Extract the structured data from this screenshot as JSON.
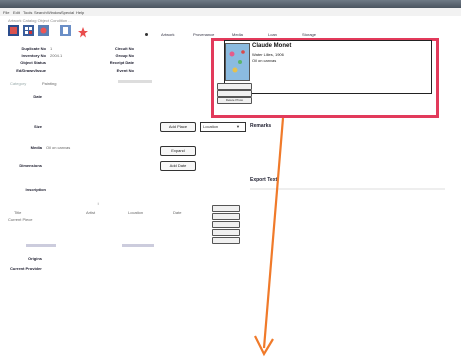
{
  "window": {
    "title": ""
  },
  "menu": {
    "items": [
      "File",
      "Edit",
      "Tools",
      "Search",
      "Window",
      "Special",
      "Help"
    ]
  },
  "breadcrumb": "Artwork  Catalog  Object  Condition  ...",
  "tabs": [
    "Artwork",
    "Provenance",
    "Media",
    "Loan",
    "Storage"
  ],
  "fields": {
    "duplicate_label": "Duplicate No",
    "duplicate_value": "1",
    "inventory_label": "Inventory No",
    "inventory_value": "2004.1",
    "object_status_label": "Object Status",
    "object_status_value": "",
    "ed_label": "Ed/Drawn/Issue",
    "ed_value": "",
    "category_label": "Category",
    "category_value": "Painting",
    "date_label": "Date",
    "date_value": "",
    "circuit_label": "Circuit No",
    "circuit_value": "",
    "group_label": "Group No",
    "group_value": "",
    "receipt_label": "Receipt Date",
    "receipt_value": "",
    "event_label": "Event No",
    "event_value": "",
    "size_label": "Size",
    "size_value": "",
    "media_label": "Media",
    "media_value": "Oil on canvas",
    "dimensions_label": "Dimensions",
    "dimensions_value": "",
    "inscription_label": "Inscription",
    "inscription_value": "",
    "origins_label": "Origins",
    "origins_value": "",
    "current_provider_label": "Current Provider",
    "current_provider_value": ""
  },
  "buttons": {
    "add_place": "Add Place",
    "expand": "Expand",
    "add_date": "Add Date",
    "photo_1": "Add Photo",
    "photo_2": "Delete",
    "photo_3": "Replace",
    "side_1": "",
    "side_2": "",
    "side_3": "",
    "side_4": "",
    "side_5": ""
  },
  "dropdown": {
    "selected": "Location"
  },
  "remarks": {
    "label": "Remarks",
    "text": ""
  },
  "export": {
    "label": "Export Text"
  },
  "card": {
    "title": "Claude Monet",
    "lines": [
      "Water Lilies, 1906",
      "Oil on canvas",
      "",
      "",
      "",
      ""
    ],
    "photo_btn_1": "",
    "photo_btn_2": "",
    "photo_btn_3": "Delete Photo"
  },
  "table": {
    "headers": [
      "Title",
      "Artist",
      "Location",
      "Date"
    ],
    "row": [
      "Current Piece",
      "",
      "",
      ""
    ]
  },
  "colors": {
    "highlight": "#e23a5b",
    "arrow": "#f07a2a"
  }
}
